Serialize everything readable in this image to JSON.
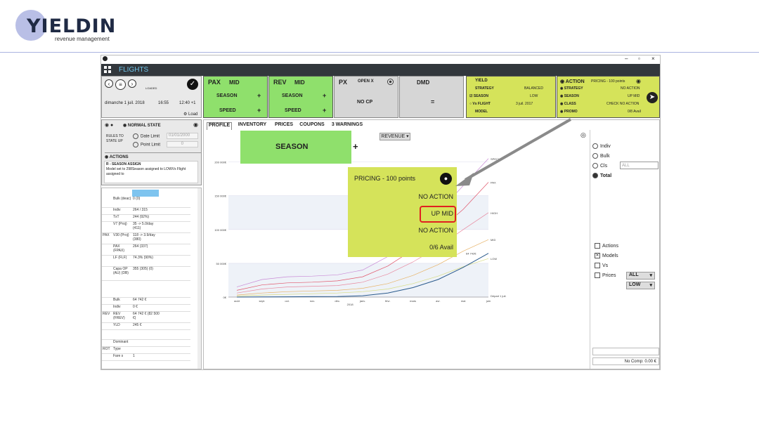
{
  "logo": {
    "name": "YIELDIN",
    "tagline": "revenue management"
  },
  "app": {
    "title": "FLIGHTS",
    "window_buttons": [
      "–",
      "▫",
      "×"
    ]
  },
  "header": {
    "loaded_label": "LOADED",
    "date": "dimanche 1 juil. 2018",
    "time1": "16:55",
    "time2": "12:40 +1",
    "load_label": "Load"
  },
  "pax": {
    "label": "PAX",
    "value": "MID",
    "row1": "SEASON",
    "row2": "SPEED"
  },
  "rev": {
    "label": "REV",
    "value": "MID",
    "row1": "SEASON",
    "row2": "SPEED"
  },
  "px": {
    "label": "PX",
    "value": "OPEN X",
    "center": "NO CP"
  },
  "dmd": {
    "label": "DMD",
    "center": "="
  },
  "plus": "+",
  "yield": {
    "title": "YIELD",
    "rows": [
      {
        "label": "STRATEGY",
        "value": "BALANCED"
      },
      {
        "label": "SEASON",
        "value": "LOW"
      },
      {
        "label": "Vs FLIGHT",
        "value": "3 juil. 2017"
      },
      {
        "label": "MODEL",
        "value": ""
      }
    ]
  },
  "action_panel": {
    "title": "ACTION",
    "subtitle": "PRICING - 100 points",
    "rows": [
      {
        "label": "STRATEGY",
        "value": "NO ACTION"
      },
      {
        "label": "SEASON",
        "value": "UP MID"
      },
      {
        "label": "CLASS",
        "value": "CHECK NO ACTION"
      },
      {
        "label": "PROMO",
        "value": "0/8 Avail"
      }
    ]
  },
  "state": {
    "title": "NORMAL STATE",
    "rules_label": "RULES TO STATE UP",
    "date_limit": "Date Limit",
    "date_value": "01/01/2000",
    "point_limit": "Point Limit",
    "point_value": "0"
  },
  "actions": {
    "title": "ACTIONS",
    "item_title": "R - SEASON ASSIGN",
    "item_text": "Model set to 298Season assigned to LOWVs Flight assigned to"
  },
  "tabs": [
    "PROFILE",
    "INVENTORY",
    "PRICES",
    "COUPONS",
    "3 WARNINGS"
  ],
  "revenue_dropdown": "REVENUE",
  "season_popup": {
    "label": "SEASON",
    "plus": "+"
  },
  "pricing_popup": {
    "title": "PRICING - 100 points",
    "lines": [
      "NO ACTION",
      "UP MID",
      "NO ACTION",
      "0/6 Avail"
    ]
  },
  "side_grid": {
    "rows": [
      {
        "group": "",
        "label": "Bulk (deac)",
        "value": "0 (0)"
      },
      {
        "group": "",
        "label": "Indiv",
        "value": "264 / 315"
      },
      {
        "group": "",
        "label": "TxT",
        "value": "244 (92%)"
      },
      {
        "group": "",
        "label": "V7 (Proj)",
        "value": "35 -> 5.0/day (411)"
      },
      {
        "group": "PAX",
        "label": "V30 (Proj)",
        "value": "118 -> 3.9/day (380)"
      },
      {
        "group": "",
        "label": "PAX (FPAX)",
        "value": "264 (337)"
      },
      {
        "group": "",
        "label": "LF (FLF)",
        "value": "74.3% (90%)"
      },
      {
        "group": "",
        "label": "Capa OP (AU) (DB)",
        "value": "355 (305) (0)"
      },
      {
        "group": "",
        "label": "",
        "value": ""
      },
      {
        "group": "",
        "label": "Bulk",
        "value": "64 742 €"
      },
      {
        "group": "",
        "label": "Indiv",
        "value": "0 €"
      },
      {
        "group": "REV",
        "label": "REV (FREV)",
        "value": "64 742 € (82 500 €)"
      },
      {
        "group": "",
        "label": "YLD",
        "value": "245 €"
      },
      {
        "group": "",
        "label": "",
        "value": ""
      },
      {
        "group": "",
        "label": "Dominant",
        "value": ""
      },
      {
        "group": "ROT",
        "label": "Type",
        "value": ""
      },
      {
        "group": "",
        "label": "Fare s",
        "value": "1"
      }
    ]
  },
  "right_panel": {
    "options": [
      "Indiv",
      "Bulk",
      "Cls",
      "Total"
    ],
    "selected": "Total",
    "cls_placeholder": "ALL",
    "checks": [
      {
        "label": "Actions",
        "checked": false
      },
      {
        "label": "Models",
        "checked": true
      },
      {
        "label": "Vs",
        "checked": false
      },
      {
        "label": "Prices",
        "checked": false
      }
    ],
    "prices_all": "ALL",
    "prices_low": "LOW",
    "no_comp": "No Comp: 0.00 €"
  },
  "chart_data": {
    "type": "line",
    "title": "",
    "xlabel": "",
    "ylabel": "",
    "y_ticks": [
      "0€",
      "50 000€",
      "100 000€",
      "150 000€",
      "200 000€"
    ],
    "ylim": [
      0,
      210000
    ],
    "x_ticks": [
      "août",
      "sept.",
      "oct.",
      "nov.",
      "déc.",
      "janv.",
      "févr.",
      "mars",
      "avr.",
      "mai",
      "juin"
    ],
    "x_year_label": "2018",
    "series": [
      {
        "name": "SPECIAL",
        "color": "#c98ad6",
        "values": [
          15000,
          26000,
          30000,
          31000,
          33000,
          40000,
          60000,
          90000,
          125000,
          165000,
          205000
        ]
      },
      {
        "name": "PAX",
        "color": "#e0556a",
        "values": [
          10000,
          18000,
          21000,
          22000,
          24000,
          30000,
          46000,
          70000,
          98000,
          130000,
          170000
        ]
      },
      {
        "name": "HIGH",
        "color": "#e88aa0",
        "values": [
          6000,
          12000,
          15000,
          16000,
          17000,
          22000,
          34000,
          52000,
          74000,
          100000,
          125000
        ]
      },
      {
        "name": "MID",
        "color": "#e7b266",
        "values": [
          3000,
          6000,
          8000,
          9000,
          10000,
          13000,
          20000,
          32000,
          48000,
          68000,
          85000
        ]
      },
      {
        "name": "LOW",
        "color": "#d7dc82",
        "values": [
          1500,
          3000,
          4000,
          5000,
          6000,
          8000,
          12000,
          20000,
          31000,
          45000,
          57000
        ]
      },
      {
        "name": "64 742€",
        "color": "#2a5a8c",
        "values": [
          0,
          200,
          400,
          600,
          800,
          2000,
          6000,
          14000,
          26000,
          44000,
          64742
        ]
      }
    ],
    "labels": [
      "SPECIAL",
      "PAX",
      "HIGH",
      "MID",
      "LOW",
      "64 742€",
      "Départ 1 juil."
    ]
  }
}
